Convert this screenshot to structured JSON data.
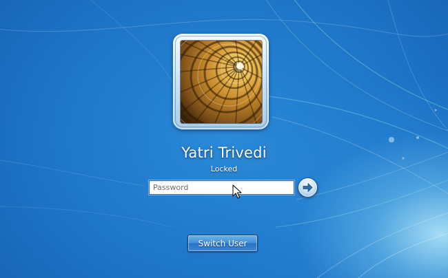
{
  "user": {
    "name": "Yatri Trivedi",
    "status": "Locked"
  },
  "login": {
    "password_placeholder": "Password",
    "password_value": "",
    "submit_icon": "arrow-right-icon"
  },
  "actions": {
    "switch_user_label": "Switch User"
  },
  "icons": {
    "avatar": "spiral-staircase-image",
    "cursor": "mouse-pointer-icon"
  },
  "colors": {
    "background": "#1d74c7",
    "background_glow": "#bef0ff",
    "button": "#3f8fd8",
    "text": "#ffffff"
  }
}
